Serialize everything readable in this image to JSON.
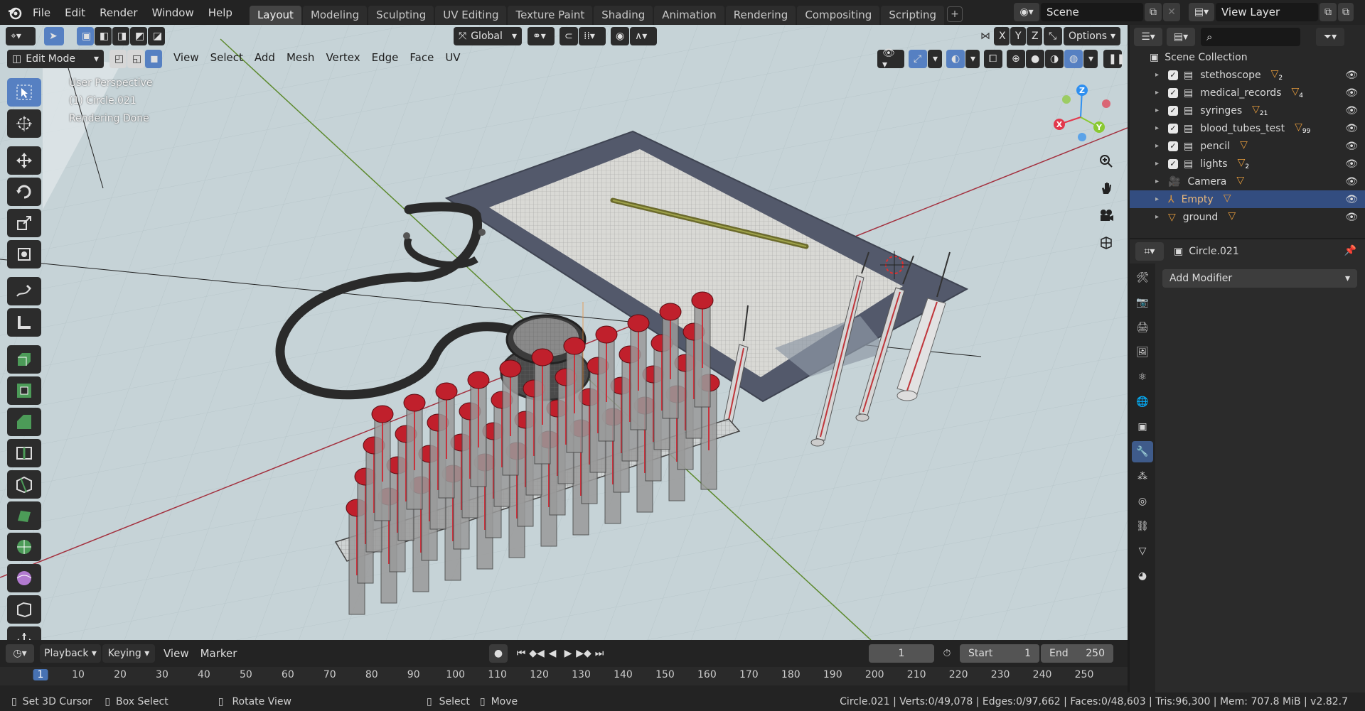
{
  "topbar": {
    "menus": [
      "File",
      "Edit",
      "Render",
      "Window",
      "Help"
    ],
    "workspaces": [
      "Layout",
      "Modeling",
      "Sculpting",
      "UV Editing",
      "Texture Paint",
      "Shading",
      "Animation",
      "Rendering",
      "Compositing",
      "Scripting"
    ],
    "active_workspace": "Layout",
    "scene": "Scene",
    "view_layer": "View Layer"
  },
  "viewport": {
    "orientation": "Global",
    "axes": [
      "X",
      "Y",
      "Z"
    ],
    "options_label": "Options",
    "mode": "Edit Mode",
    "menus": [
      "View",
      "Select",
      "Add",
      "Mesh",
      "Vertex",
      "Edge",
      "Face",
      "UV"
    ],
    "info_lines": [
      "User Perspective",
      "(1) Circle.021",
      "Rendering Done"
    ],
    "gizmo_axes": {
      "x": "X",
      "y": "Y",
      "z": "Z"
    },
    "colors": {
      "x": "#e2384c",
      "y": "#8ac932",
      "z": "#2e8ff0",
      "background": "#c6d3d7"
    }
  },
  "timeline": {
    "menus": [
      "Playback",
      "Keying",
      "View",
      "Marker"
    ],
    "current_frame": "1",
    "start_label": "Start",
    "start": "1",
    "end_label": "End",
    "end": "250",
    "ruler": [
      "1",
      "10",
      "20",
      "30",
      "40",
      "50",
      "60",
      "70",
      "80",
      "90",
      "100",
      "110",
      "120",
      "130",
      "140",
      "150",
      "160",
      "170",
      "180",
      "190",
      "200",
      "210",
      "220",
      "230",
      "240",
      "250"
    ]
  },
  "outliner": {
    "root": "Scene Collection",
    "items": [
      {
        "name": "stethoscope",
        "type": "collection",
        "badge": "2"
      },
      {
        "name": "medical_records",
        "type": "collection",
        "badge": "4"
      },
      {
        "name": "syringes",
        "type": "collection",
        "badge": "21"
      },
      {
        "name": "blood_tubes_test",
        "type": "collection",
        "badge": "99"
      },
      {
        "name": "pencil",
        "type": "collection",
        "badge": ""
      },
      {
        "name": "lights",
        "type": "collection",
        "badge": "2"
      },
      {
        "name": "Camera",
        "type": "camera",
        "badge": ""
      },
      {
        "name": "Empty",
        "type": "empty",
        "badge": ""
      },
      {
        "name": "ground",
        "type": "mesh",
        "badge": ""
      }
    ]
  },
  "properties": {
    "object_name": "Circle.021",
    "add_modifier": "Add Modifier"
  },
  "statusbar": {
    "hints": [
      "Set 3D Cursor",
      "Box Select",
      "Rotate View",
      "Select",
      "Move"
    ],
    "stats": "Circle.021 | Verts:0/49,078 | Edges:0/97,662 | Faces:0/48,603 | Tris:96,300 | Mem: 707.8 MiB | v2.82.7"
  }
}
